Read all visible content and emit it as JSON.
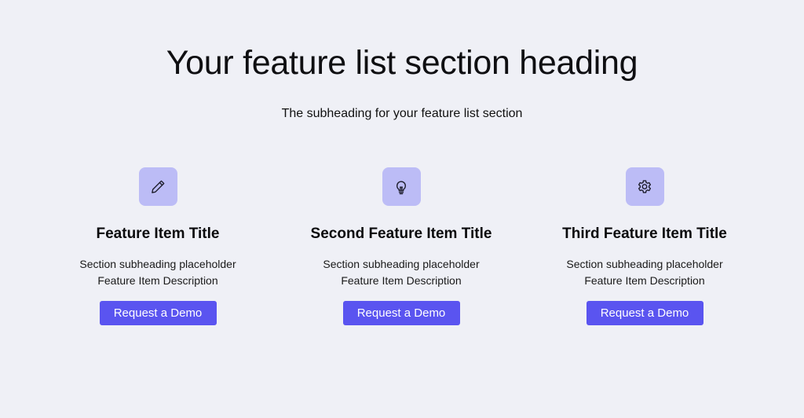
{
  "section": {
    "heading": "Your feature list section heading",
    "subheading": "The subheading for your feature list section"
  },
  "features": [
    {
      "icon": "pencil-icon",
      "title": "Feature Item Title",
      "description_line1": "Section subheading placeholder",
      "description_line2": "Feature Item Description",
      "button_label": "Request a Demo"
    },
    {
      "icon": "lightbulb-icon",
      "title": "Second Feature Item Title",
      "description_line1": "Section subheading placeholder",
      "description_line2": "Feature Item Description",
      "button_label": "Request a Demo"
    },
    {
      "icon": "gear-icon",
      "title": "Third Feature Item Title",
      "description_line1": "Section subheading placeholder",
      "description_line2": "Feature Item Description",
      "button_label": "Request a Demo"
    }
  ],
  "colors": {
    "background": "#eff0f6",
    "icon_tile": "#bcbcf6",
    "button": "#5a54f0",
    "button_text": "#ffffff",
    "text": "#111111"
  }
}
